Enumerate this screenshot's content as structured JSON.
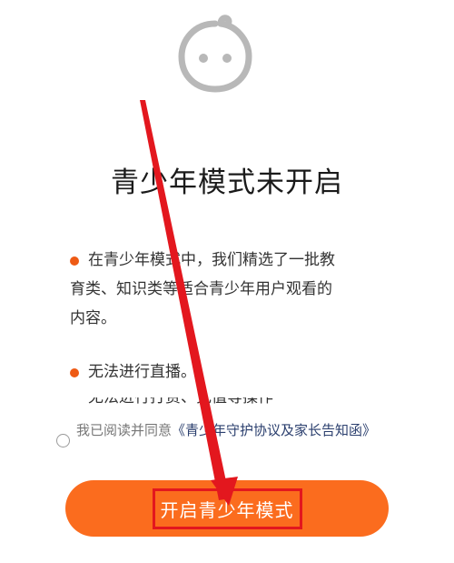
{
  "icons": {
    "face": "baby-face-icon",
    "bullet": "bullet-dot-icon",
    "radio": "radio-unchecked-icon"
  },
  "colors": {
    "accent": "#fb6c1e",
    "bullet": "#ee5a14",
    "link": "#2b3f6e",
    "annotation": "#e3171e"
  },
  "title": "青少年模式未开启",
  "bullets": [
    {
      "line1": "在青少年模式中，我们精选了一批教",
      "line2": "育类、知识类等适合青少年用户观看的",
      "line3": "内容。"
    },
    {
      "text": "无法进行直播。"
    },
    {
      "text": "无法进行打赏、充值等操作"
    }
  ],
  "agreement": {
    "prefix": "我已阅读并同意",
    "link": "《青少年守护协议及家长告知函》"
  },
  "cta_label": "开启青少年模式"
}
